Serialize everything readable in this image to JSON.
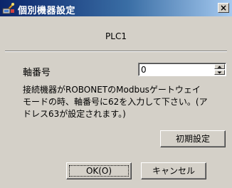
{
  "window": {
    "title": "個別機器設定",
    "close_label": "×"
  },
  "device": {
    "name": "PLC1"
  },
  "axis_number": {
    "label": "軸番号",
    "value": "0"
  },
  "description": {
    "lines": [
      "接続機器がROBONETのModbusゲートウェイ",
      "モードの時、軸番号に62を入力して下さい。(ア",
      "ドレス63が設定されます。)"
    ]
  },
  "buttons": {
    "init_label": "初期設定",
    "ok_label": "OK(O)",
    "cancel_label": "キャンセル"
  }
}
